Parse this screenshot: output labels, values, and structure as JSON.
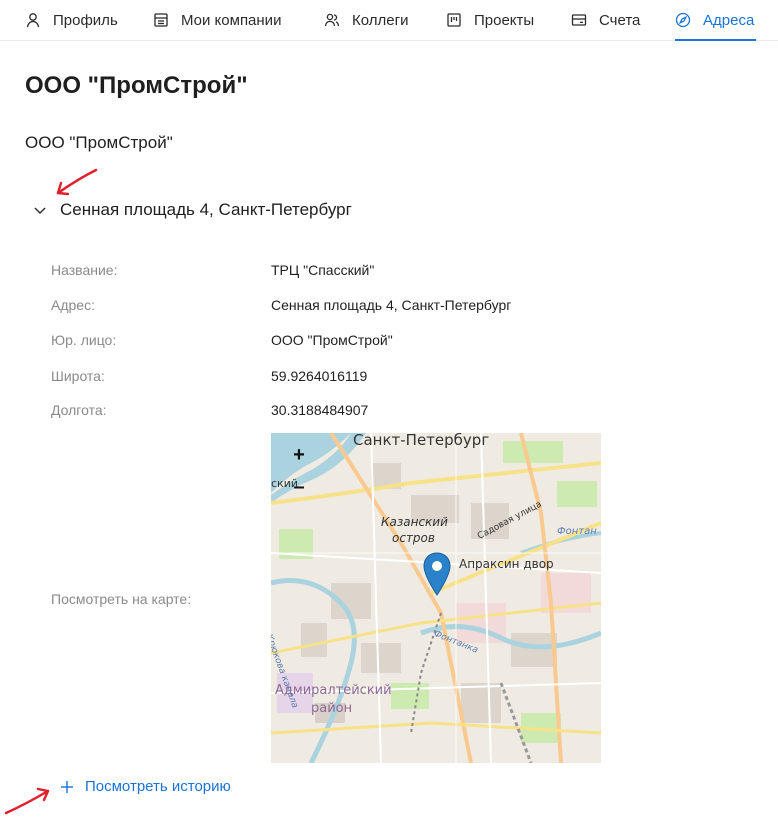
{
  "nav": {
    "items": [
      {
        "label": "Профиль",
        "icon": "user-icon"
      },
      {
        "label": "Мои компании",
        "icon": "building-icon"
      },
      {
        "label": "Коллеги",
        "icon": "users-icon"
      },
      {
        "label": "Проекты",
        "icon": "project-icon"
      },
      {
        "label": "Счета",
        "icon": "card-icon"
      },
      {
        "label": "Адреса",
        "icon": "compass-icon",
        "active": true
      }
    ],
    "active_color": "#1a73d9"
  },
  "page": {
    "title": "ООО \"ПромСтрой\"",
    "company_name": "ООО \"ПромСтрой\""
  },
  "address": {
    "header": "Сенная площадь 4, Санкт-Петербург",
    "expanded": true,
    "fields": [
      {
        "label": "Название:",
        "value": "ТРЦ \"Спасский\""
      },
      {
        "label": "Адрес:",
        "value": "Сенная площадь 4, Санкт-Петербург"
      },
      {
        "label": "Юр. лицо:",
        "value": "ООО \"ПромСтрой\""
      },
      {
        "label": "Широта:",
        "value": "59.9264016119"
      },
      {
        "label": "Долгота:",
        "value": "30.3188484907"
      }
    ],
    "map_label": "Посмотреть на карте:"
  },
  "map": {
    "zoom_in": "+",
    "zoom_out": "–",
    "labels": {
      "city": "Санкт-Петербург",
      "edge": "ский",
      "island_1": "Казанский",
      "island_2": "остров",
      "poi": "Апраксин двор",
      "street_1": "Садовая улица",
      "street_2": "Фонтан",
      "canal_1": "Фонтанка",
      "canal_2": "Крюкова канала",
      "district_1": "Адмиралтейский",
      "district_2": "район"
    }
  },
  "history": {
    "label": "Посмотреть историю"
  }
}
